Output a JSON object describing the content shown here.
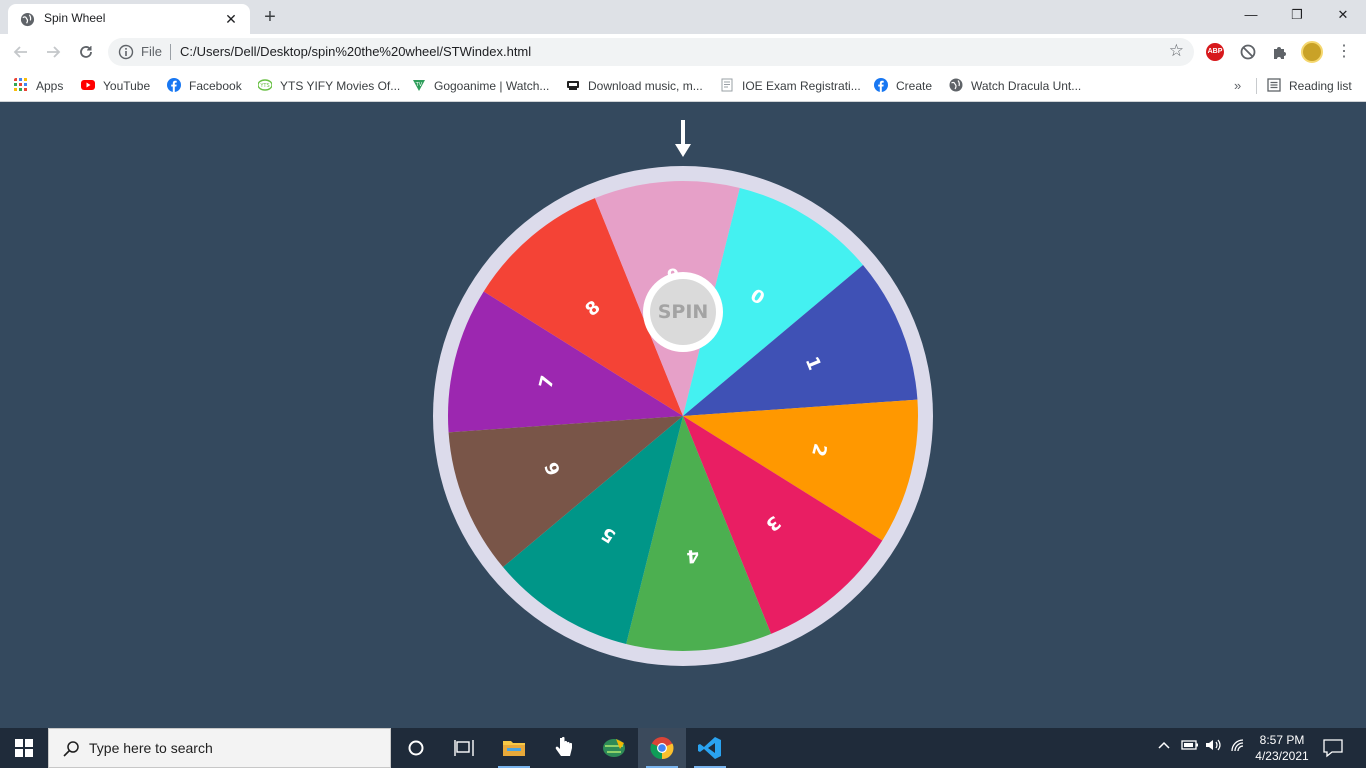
{
  "browser": {
    "tab_title": "Spin Wheel",
    "new_tab_label": "+",
    "close_tab_label": "✕",
    "window_controls": {
      "minimize": "—",
      "restore": "❐",
      "close": "✕"
    },
    "scheme_label": "File",
    "url": "C:/Users/Dell/Desktop/spin%20the%20wheel/STWindex.html"
  },
  "bookmarks": {
    "items": [
      {
        "label": "Apps",
        "icon": "apps-grid-icon",
        "color": "#ea4335"
      },
      {
        "label": "YouTube",
        "icon": "youtube-icon",
        "color": "#ff0000"
      },
      {
        "label": "Facebook",
        "icon": "facebook-icon",
        "color": "#1877f2"
      },
      {
        "label": "YTS YIFY Movies Of...",
        "icon": "yts-icon",
        "color": "#6ac045"
      },
      {
        "label": "Gogoanime | Watch...",
        "icon": "gogoanime-icon",
        "color": "#2e9e5b"
      },
      {
        "label": "Download music, m...",
        "icon": "music-download-icon",
        "color": "#222222"
      },
      {
        "label": "IOE Exam Registrati...",
        "icon": "document-icon",
        "color": "#9aa0a6"
      },
      {
        "label": "Create",
        "icon": "facebook-icon",
        "color": "#1877f2"
      },
      {
        "label": "Watch Dracula Unt...",
        "icon": "globe-icon",
        "color": "#5f6368"
      }
    ],
    "more_label": "»",
    "reading_list_label": "Reading list"
  },
  "wheel": {
    "spin_label": "SPIN",
    "rim_color": "#dcdbeb",
    "segments": [
      {
        "label": "7",
        "color": "#9c27b0"
      },
      {
        "label": "8",
        "color": "#f44336"
      },
      {
        "label": "9",
        "color": "#e6a0c8"
      },
      {
        "label": "0",
        "color": "#44f1f1"
      },
      {
        "label": "1",
        "color": "#3f51b5"
      },
      {
        "label": "2",
        "color": "#ff9800"
      },
      {
        "label": "3",
        "color": "#e91e63"
      },
      {
        "label": "4",
        "color": "#4caf50"
      },
      {
        "label": "5",
        "color": "#009688"
      },
      {
        "label": "6",
        "color": "#795548"
      }
    ]
  },
  "taskbar": {
    "search_placeholder": "Type here to search",
    "time": "8:57 PM",
    "date": "4/23/2021"
  }
}
